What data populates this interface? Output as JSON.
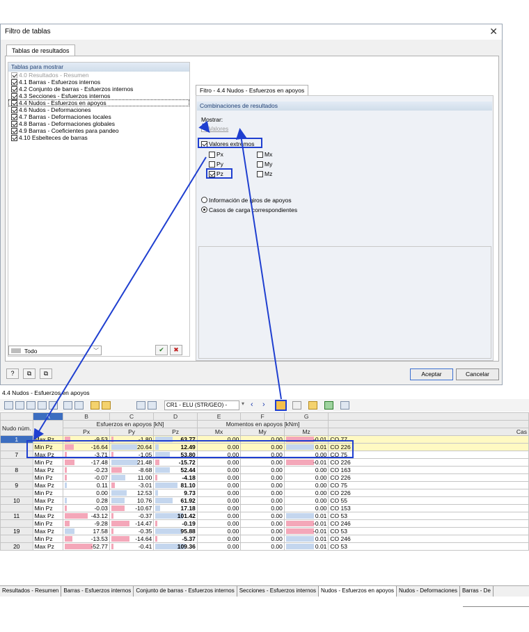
{
  "dialog": {
    "title": "Filtro de tablas",
    "main_tab": "Tablas de resultados",
    "left_header": "Tablas para mostrar",
    "tables": [
      {
        "label": "4.0 Resultados - Resumen",
        "checked": true,
        "disabled": true
      },
      {
        "label": "4.1 Barras - Esfuerzos internos",
        "checked": true
      },
      {
        "label": "4.2 Conjunto de barras - Esfuerzos internos",
        "checked": true
      },
      {
        "label": "4.3 Secciones - Esfuerzos internos",
        "checked": true
      },
      {
        "label": "4.4 Nudos - Esfuerzos en apoyos",
        "checked": true,
        "selected": true
      },
      {
        "label": "4.6 Nudos - Deformaciones",
        "checked": true
      },
      {
        "label": "4.7 Barras - Deformaciones locales",
        "checked": true
      },
      {
        "label": "4.8 Barras - Deformaciones globales",
        "checked": true
      },
      {
        "label": "4.9 Barras - Coeficientes para pandeo",
        "checked": true
      },
      {
        "label": "4.10 Esbelteces de barras",
        "checked": true
      }
    ],
    "filter_select": "Todo",
    "right_tab": "Fitro - 4.4 Nudos - Esfuerzos en apoyos",
    "right_header": "Combinaciones de resultados",
    "mostrar_label": "Mostrar:",
    "valores_label": "Valores",
    "extremos_label": "Valores extremos",
    "comp": {
      "px": "Px",
      "py": "Py",
      "pz": "Pz",
      "mx": "Mx",
      "my": "My",
      "mz": "Mz"
    },
    "radio_giros": "Información de giros de apoyos",
    "radio_casos": "Casos de carga correspondientes",
    "ok": "Aceptar",
    "cancel": "Cancelar"
  },
  "results": {
    "title": "4.4 Nudos - Esfuerzos en apoyos",
    "combo": "CR1 - ELU (STR/GEO) -",
    "col_letters": [
      "A",
      "B",
      "C",
      "D",
      "E",
      "F",
      "G"
    ],
    "node_header": "Nudo núm.",
    "group_forces": "Esfuerzos en apoyos [kN]",
    "group_moments": "Momentos en apoyos [kNm]",
    "sub_headers": [
      "Px",
      "Py",
      "Pz",
      "Mx",
      "My",
      "Mz"
    ],
    "case_header": "Cas",
    "rows": [
      {
        "node": "1",
        "type": "Max Pz",
        "px": "-9.53",
        "py": "-1.80",
        "pz": "63.77",
        "mx": "0.00",
        "my": "0.00",
        "mz": "-0.01",
        "case": "CO 77"
      },
      {
        "node": "",
        "type": "Min Pz",
        "px": "-16.64",
        "py": "20.64",
        "pz": "12.49",
        "mx": "0.00",
        "my": "0.00",
        "mz": "0.01",
        "case": "CO 226"
      },
      {
        "node": "7",
        "type": "Max Pz",
        "px": "-3.71",
        "py": "-1.05",
        "pz": "53.80",
        "mx": "0.00",
        "my": "0.00",
        "mz": "0.00",
        "case": "CO 75"
      },
      {
        "node": "",
        "type": "Min Pz",
        "px": "-17.48",
        "py": "21.48",
        "pz": "-15.72",
        "mx": "0.00",
        "my": "0.00",
        "mz": "-0.01",
        "case": "CO 226"
      },
      {
        "node": "8",
        "type": "Max Pz",
        "px": "-0.23",
        "py": "-8.68",
        "pz": "52.44",
        "mx": "0.00",
        "my": "0.00",
        "mz": "0.00",
        "case": "CO 163"
      },
      {
        "node": "",
        "type": "Min Pz",
        "px": "-0.07",
        "py": "11.00",
        "pz": "-4.18",
        "mx": "0.00",
        "my": "0.00",
        "mz": "0.00",
        "case": "CO 226"
      },
      {
        "node": "9",
        "type": "Max Pz",
        "px": "0.11",
        "py": "-3.01",
        "pz": "81.10",
        "mx": "0.00",
        "my": "0.00",
        "mz": "0.00",
        "case": "CO 75"
      },
      {
        "node": "",
        "type": "Min Pz",
        "px": "0.00",
        "py": "12.53",
        "pz": "9.73",
        "mx": "0.00",
        "my": "0.00",
        "mz": "0.00",
        "case": "CO 226"
      },
      {
        "node": "10",
        "type": "Max Pz",
        "px": "0.28",
        "py": "10.76",
        "pz": "61.92",
        "mx": "0.00",
        "my": "0.00",
        "mz": "0.00",
        "case": "CO 55"
      },
      {
        "node": "",
        "type": "Min Pz",
        "px": "-0.03",
        "py": "-10.67",
        "pz": "17.18",
        "mx": "0.00",
        "my": "0.00",
        "mz": "0.00",
        "case": "CO 153"
      },
      {
        "node": "11",
        "type": "Max Pz",
        "px": "-43.12",
        "py": "-0.37",
        "pz": "101.42",
        "mx": "0.00",
        "my": "0.00",
        "mz": "0.01",
        "case": "CO 53"
      },
      {
        "node": "",
        "type": "Min Pz",
        "px": "-9.28",
        "py": "-14.47",
        "pz": "-0.19",
        "mx": "0.00",
        "my": "0.00",
        "mz": "-0.01",
        "case": "CO 246"
      },
      {
        "node": "19",
        "type": "Max Pz",
        "px": "17.58",
        "py": "-0.35",
        "pz": "95.88",
        "mx": "0.00",
        "my": "0.00",
        "mz": "-0.01",
        "case": "CO 53"
      },
      {
        "node": "",
        "type": "Min Pz",
        "px": "-13.53",
        "py": "-14.64",
        "pz": "-5.37",
        "mx": "0.00",
        "my": "0.00",
        "mz": "0.01",
        "case": "CO 246"
      },
      {
        "node": "20",
        "type": "Max Pz",
        "px": "-52.77",
        "py": "-0.41",
        "pz": "109.36",
        "mx": "0.00",
        "my": "0.00",
        "mz": "0.01",
        "case": "CO 53"
      }
    ],
    "sheet_tabs": [
      "Resultados - Resumen",
      "Barras - Esfuerzos internos",
      "Conjunto de barras - Esfuerzos internos",
      "Secciones - Esfuerzos internos",
      "Nudos - Esfuerzos en apoyos",
      "Nudos - Deformaciones",
      "Barras - De"
    ]
  },
  "colors": {
    "highlight": "#1f3fd0",
    "negative_bar": "#f4a7b9",
    "positive_bar": "#c4d6ee",
    "selected_row": "#fff9c2"
  }
}
